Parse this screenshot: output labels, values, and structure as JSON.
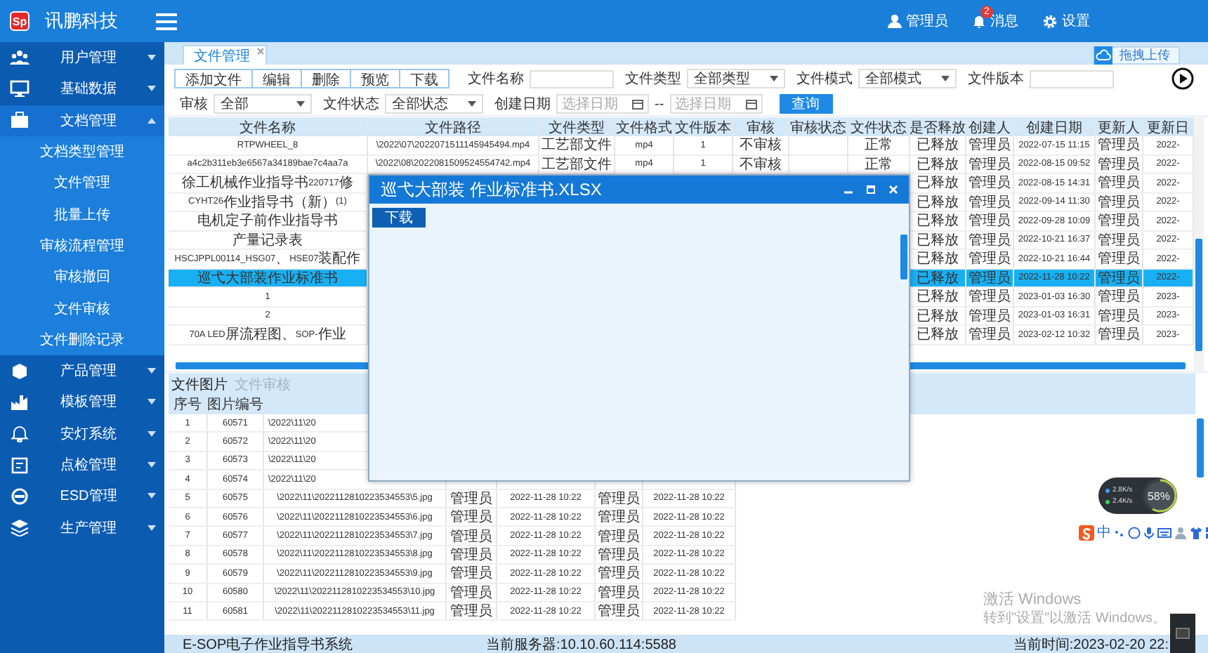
{
  "header": {
    "logo": "Sp",
    "title": "讯鹏科技",
    "user": "管理员",
    "messages": "消息",
    "badge": "2",
    "settings": "设置"
  },
  "sidebar": {
    "groups": [
      {
        "label": "用户管理",
        "expanded": false
      },
      {
        "label": "基础数据",
        "expanded": false
      },
      {
        "label": "文档管理",
        "expanded": true,
        "children": [
          {
            "label": "文档类型管理",
            "selected": false
          },
          {
            "label": "文件管理",
            "selected": false
          },
          {
            "label": "批量上传",
            "selected": false
          },
          {
            "label": "审核流程管理",
            "selected": false
          },
          {
            "label": "审核撤回",
            "selected": false
          },
          {
            "label": "文件审核",
            "selected": false
          },
          {
            "label": "文件删除记录",
            "selected": false
          }
        ]
      },
      {
        "label": "产品管理",
        "expanded": false
      },
      {
        "label": "模板管理",
        "expanded": false
      },
      {
        "label": "安灯系统",
        "expanded": false
      },
      {
        "label": "点检管理",
        "expanded": false
      },
      {
        "label": "ESD管理",
        "expanded": false
      },
      {
        "label": "生产管理",
        "expanded": false
      }
    ]
  },
  "tabs": [
    {
      "label": "文件管理",
      "selected": true
    }
  ],
  "upload_button": "拖拽上传",
  "filter_rows": [
    [
      {
        "kind": "button_group",
        "buttons": [
          "添加文件",
          "编辑",
          "删除",
          "预览",
          "下载"
        ]
      },
      {
        "kind": "input",
        "label": "文件名称"
      },
      {
        "kind": "select",
        "label": "文件类型",
        "value": "全部类型"
      },
      {
        "kind": "select",
        "label": "文件模式",
        "value": "全部模式"
      },
      {
        "kind": "input",
        "label": "文件版本"
      }
    ],
    [
      {
        "kind": "select",
        "label": "审核",
        "value": "全部"
      },
      {
        "kind": "select",
        "label": "文件状态",
        "value": "全部状态"
      },
      {
        "kind": "daterange",
        "label": "创建日期",
        "from_placeholder": "选择日期",
        "separator": "--",
        "to_placeholder": "选择日期"
      },
      {
        "kind": "button",
        "label": "查询"
      }
    ]
  ],
  "file_table": {
    "columns": [
      "文件名称",
      "文件路径",
      "文件类型",
      "文件格式",
      "文件版本",
      "审核",
      "审核状态",
      "文件状态",
      "是否释放",
      "创建人",
      "创建日期",
      "更新人",
      "更新日"
    ],
    "rows": [
      {
        "selected": false,
        "cells": [
          "RTPWHEEL_8",
          "\\2022\\07\\2022071511145945494.mp4",
          "工艺部文件",
          "mp4",
          "1",
          "不审核",
          null,
          "正常",
          "已释放",
          "管理员",
          "2022-07-15 11:15",
          "管理员",
          "2022-"
        ]
      },
      {
        "selected": false,
        "cells": [
          "a4c2b311eb3e6567a34189bae7c4aa7a",
          "\\2022\\08\\2022081509524554742.mp4",
          "工艺部文件",
          "mp4",
          "1",
          "不审核",
          null,
          "正常",
          "已释放",
          "管理员",
          "2022-08-15 09:52",
          "管理员",
          "2022-"
        ]
      },
      {
        "selected": false,
        "cells": [
          "徐工机械作业指导书220717修",
          null,
          null,
          null,
          null,
          null,
          null,
          null,
          "已释放",
          "管理员",
          "2022-08-15 14:31",
          "管理员",
          "2022-"
        ]
      },
      {
        "selected": false,
        "cells": [
          "CYHT26作业指导书（新）(1)",
          null,
          null,
          null,
          null,
          null,
          null,
          null,
          "已释放",
          "管理员",
          "2022-09-14 11:30",
          "管理员",
          "2022-"
        ]
      },
      {
        "selected": false,
        "cells": [
          "电机定子前作业指导书",
          null,
          null,
          null,
          null,
          null,
          null,
          null,
          "已释放",
          "管理员",
          "2022-09-28 10:09",
          "管理员",
          "2022-"
        ]
      },
      {
        "selected": false,
        "cells": [
          "产量记录表",
          null,
          null,
          null,
          null,
          null,
          null,
          null,
          "已释放",
          "管理员",
          "2022-10-21 16:37",
          "管理员",
          "2022-"
        ]
      },
      {
        "selected": false,
        "cells": [
          "HSCJPPL00114_HSG07、HSE07装配作",
          null,
          null,
          null,
          null,
          null,
          null,
          null,
          "已释放",
          "管理员",
          "2022-10-21 16:44",
          "管理员",
          "2022-"
        ]
      },
      {
        "selected": true,
        "cells": [
          "巡弋大部装 作业标准书",
          null,
          null,
          null,
          null,
          null,
          null,
          null,
          "已释放",
          "管理员",
          "2022-11-28 10:22",
          "管理员",
          "2022-"
        ]
      },
      {
        "selected": false,
        "cells": [
          "1",
          null,
          null,
          null,
          null,
          null,
          null,
          null,
          "已释放",
          "管理员",
          "2023-01-03 16:30",
          "管理员",
          "2023-"
        ]
      },
      {
        "selected": false,
        "cells": [
          "2",
          null,
          null,
          null,
          null,
          null,
          null,
          null,
          "已释放",
          "管理员",
          "2023-01-03 16:31",
          "管理员",
          "2023-"
        ]
      },
      {
        "selected": false,
        "cells": [
          "70A LED屏 流程图、SOP-作业",
          null,
          null,
          null,
          null,
          null,
          null,
          null,
          "已释放",
          "管理员",
          "2023-02-12 10:32",
          "管理员",
          "2023-"
        ]
      }
    ]
  },
  "dialog": {
    "title": "巡弋大部装 作业标准书.XLSX",
    "button": "下载"
  },
  "bottom_tabs": [
    {
      "label": "文件图片",
      "selected": true
    },
    {
      "label": "文件审核",
      "selected": false
    }
  ],
  "image_table": {
    "columns": [
      "序号",
      "图片编号"
    ],
    "rows": [
      [
        "1",
        "60571",
        "\\2022\\11\\20",
        null,
        null,
        null,
        null
      ],
      [
        "2",
        "60572",
        "\\2022\\11\\20",
        null,
        null,
        null,
        null
      ],
      [
        "3",
        "60573",
        "\\2022\\11\\20",
        null,
        null,
        null,
        null
      ],
      [
        "4",
        "60574",
        "\\2022\\11\\20",
        null,
        null,
        null,
        null
      ],
      [
        "5",
        "60575",
        "\\2022\\11\\2022112810223534553\\5.jpg",
        "管理员",
        "2022-11-28 10:22",
        "管理员",
        "2022-11-28 10:22"
      ],
      [
        "6",
        "60576",
        "\\2022\\11\\2022112810223534553\\6.jpg",
        "管理员",
        "2022-11-28 10:22",
        "管理员",
        "2022-11-28 10:22"
      ],
      [
        "7",
        "60577",
        "\\2022\\11\\2022112810223534553\\7.jpg",
        "管理员",
        "2022-11-28 10:22",
        "管理员",
        "2022-11-28 10:22"
      ],
      [
        "8",
        "60578",
        "\\2022\\11\\2022112810223534553\\8.jpg",
        "管理员",
        "2022-11-28 10:22",
        "管理员",
        "2022-11-28 10:22"
      ],
      [
        "9",
        "60579",
        "\\2022\\11\\2022112810223534553\\9.jpg",
        "管理员",
        "2022-11-28 10:22",
        "管理员",
        "2022-11-28 10:22"
      ],
      [
        "10",
        "60580",
        "\\2022\\11\\2022112810223534553\\10.jpg",
        "管理员",
        "2022-11-28 10:22",
        "管理员",
        "2022-11-28 10:22"
      ],
      [
        "11",
        "60581",
        "\\2022\\11\\2022112810223534553\\11.jpg",
        "管理员",
        "2022-11-28 10:22",
        "管理员",
        "2022-11-28 10:22"
      ]
    ]
  },
  "status_bar": {
    "system": "E-SOP电子作业指导书系统",
    "server": "当前服务器:10.10.60.114:5588",
    "time": "当前时间:2023-02-20 22:"
  },
  "net_meter": {
    "upload": "2.8K/s",
    "download": "2.4K/s",
    "usage": "58%",
    "level": 0.58
  },
  "ime": {
    "mode": "中"
  },
  "activation": {
    "title": "激活 Windows",
    "hint": "转到\"设置\"以激活 Windows。"
  }
}
